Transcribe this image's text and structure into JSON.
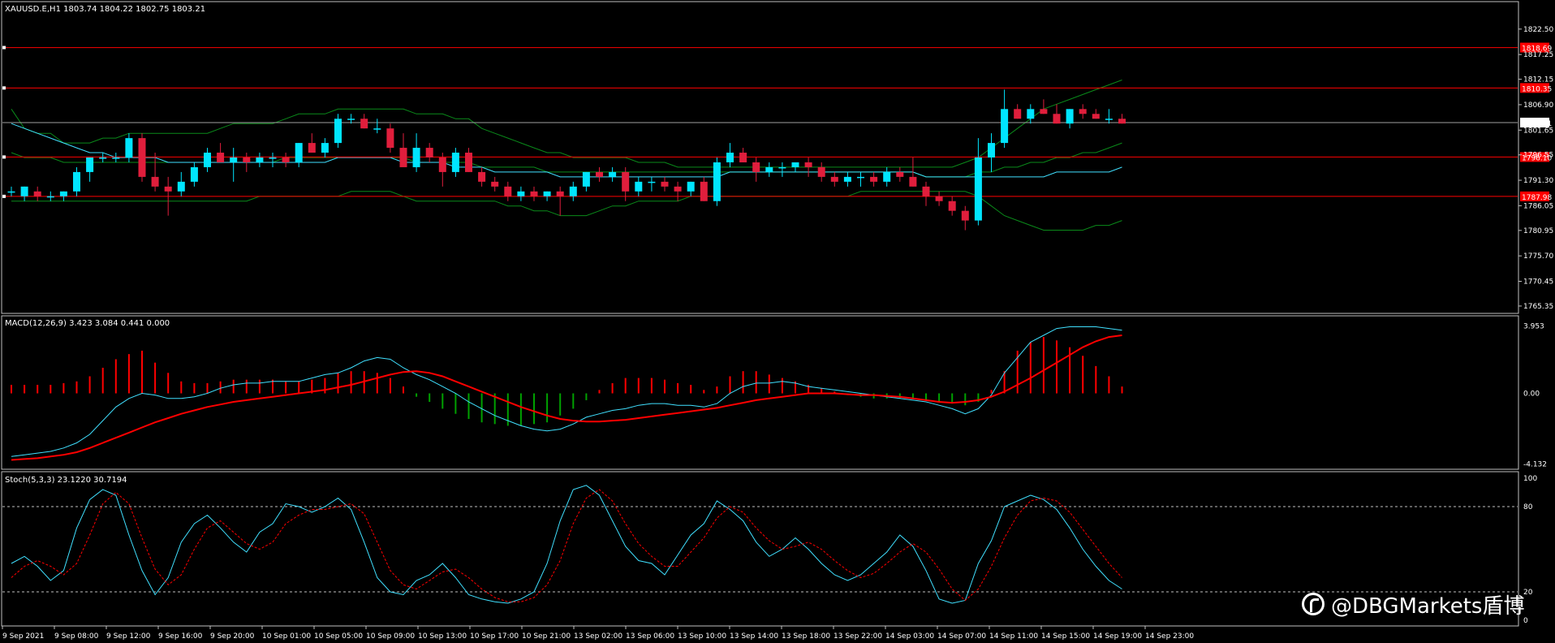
{
  "main": {
    "symbol_info": "XAUUSD.E,H1  1803.74 1804.22 1802.75 1803.21",
    "yrange": [
      1764.0,
      1828.0
    ],
    "price_ticks": [
      "1822.50",
      "1817.25",
      "1812.15",
      "1806.90",
      "1801.65",
      "1796.55",
      "1791.30",
      "1786.05",
      "1780.95",
      "1775.70",
      "1770.45",
      "1765.35"
    ],
    "price_tick_values": [
      1822.5,
      1817.25,
      1812.15,
      1806.9,
      1801.65,
      1796.55,
      1791.3,
      1786.05,
      1780.95,
      1775.7,
      1770.45,
      1765.35
    ],
    "hlines": [
      {
        "label": "1818.69",
        "value": 1818.69
      },
      {
        "label": "1810.35",
        "value": 1810.35
      },
      {
        "label": "1796.10",
        "value": 1796.1
      },
      {
        "label": "1787.98",
        "value": 1787.98
      }
    ],
    "current_price": {
      "label": "1803.21",
      "value": 1803.21
    },
    "candles": [
      [
        1789,
        1790,
        1788,
        1789
      ],
      [
        1788,
        1790,
        1787,
        1790
      ],
      [
        1789,
        1790,
        1787,
        1788
      ],
      [
        1788,
        1789,
        1787,
        1788
      ],
      [
        1788,
        1789,
        1787,
        1789
      ],
      [
        1789,
        1794,
        1788,
        1793
      ],
      [
        1793,
        1796,
        1791,
        1796
      ],
      [
        1796,
        1797,
        1795,
        1796
      ],
      [
        1796,
        1797,
        1795,
        1796
      ],
      [
        1796,
        1801,
        1795,
        1800
      ],
      [
        1800,
        1801,
        1791,
        1792
      ],
      [
        1792,
        1797,
        1789,
        1790
      ],
      [
        1790,
        1792,
        1784,
        1789
      ],
      [
        1789,
        1793,
        1788,
        1791
      ],
      [
        1791,
        1795,
        1790,
        1794
      ],
      [
        1794,
        1798,
        1793,
        1797
      ],
      [
        1797,
        1799,
        1795,
        1795
      ],
      [
        1795,
        1798,
        1791,
        1796
      ],
      [
        1796,
        1797,
        1793,
        1795
      ],
      [
        1795,
        1797,
        1794,
        1796
      ],
      [
        1796,
        1797,
        1794,
        1796
      ],
      [
        1796,
        1797,
        1794,
        1795
      ],
      [
        1795,
        1799,
        1794,
        1799
      ],
      [
        1799,
        1801,
        1797,
        1797
      ],
      [
        1797,
        1800,
        1796,
        1799
      ],
      [
        1799,
        1805,
        1798,
        1804
      ],
      [
        1804,
        1805,
        1803,
        1804
      ],
      [
        1804,
        1805,
        1802,
        1802
      ],
      [
        1802,
        1804,
        1801,
        1802
      ],
      [
        1802,
        1803,
        1797,
        1798
      ],
      [
        1798,
        1801,
        1795,
        1794
      ],
      [
        1794,
        1801,
        1793,
        1798
      ],
      [
        1798,
        1799,
        1795,
        1796
      ],
      [
        1796,
        1797,
        1790,
        1793
      ],
      [
        1793,
        1798,
        1792,
        1797
      ],
      [
        1797,
        1798,
        1793,
        1793
      ],
      [
        1793,
        1794,
        1790,
        1791
      ],
      [
        1791,
        1792,
        1789,
        1790
      ],
      [
        1790,
        1791,
        1787,
        1788
      ],
      [
        1788,
        1790,
        1787,
        1789
      ],
      [
        1789,
        1790,
        1787,
        1788
      ],
      [
        1788,
        1789,
        1787,
        1789
      ],
      [
        1789,
        1790,
        1784,
        1788
      ],
      [
        1788,
        1791,
        1787,
        1790
      ],
      [
        1790,
        1793,
        1789,
        1793
      ],
      [
        1793,
        1794,
        1791,
        1792
      ],
      [
        1792,
        1794,
        1791,
        1793
      ],
      [
        1793,
        1794,
        1787,
        1789
      ],
      [
        1789,
        1792,
        1788,
        1791
      ],
      [
        1791,
        1792,
        1789,
        1791
      ],
      [
        1791,
        1792,
        1789,
        1790
      ],
      [
        1790,
        1791,
        1787,
        1789
      ],
      [
        1789,
        1791,
        1788,
        1791
      ],
      [
        1791,
        1792,
        1787,
        1787
      ],
      [
        1787,
        1796,
        1786,
        1795
      ],
      [
        1795,
        1799,
        1794,
        1797
      ],
      [
        1797,
        1798,
        1795,
        1795
      ],
      [
        1795,
        1796,
        1791,
        1793
      ],
      [
        1793,
        1795,
        1792,
        1794
      ],
      [
        1794,
        1795,
        1792,
        1794
      ],
      [
        1794,
        1795,
        1793,
        1795
      ],
      [
        1795,
        1796,
        1792,
        1794
      ],
      [
        1794,
        1795,
        1791,
        1792
      ],
      [
        1792,
        1793,
        1790,
        1791
      ],
      [
        1791,
        1793,
        1790,
        1792
      ],
      [
        1792,
        1793,
        1790,
        1792
      ],
      [
        1792,
        1793,
        1790,
        1791
      ],
      [
        1791,
        1794,
        1790,
        1793
      ],
      [
        1793,
        1794,
        1791,
        1792
      ],
      [
        1792,
        1796,
        1790,
        1790
      ],
      [
        1790,
        1791,
        1786,
        1788
      ],
      [
        1788,
        1789,
        1786,
        1787
      ],
      [
        1787,
        1788,
        1784,
        1785
      ],
      [
        1785,
        1786,
        1781,
        1783
      ],
      [
        1783,
        1800,
        1782,
        1796
      ],
      [
        1796,
        1801,
        1793,
        1799
      ],
      [
        1799,
        1810,
        1798,
        1806
      ],
      [
        1806,
        1807,
        1804,
        1804
      ],
      [
        1804,
        1807,
        1803,
        1806
      ],
      [
        1806,
        1808,
        1805,
        1805
      ],
      [
        1805,
        1807,
        1803,
        1803
      ],
      [
        1803,
        1806,
        1802,
        1806
      ],
      [
        1806,
        1807,
        1804,
        1805
      ],
      [
        1805,
        1806,
        1804,
        1804
      ],
      [
        1804,
        1806,
        1803,
        1804
      ],
      [
        1804,
        1805,
        1803,
        1803
      ]
    ],
    "bands": {
      "upper": [
        1806,
        1802,
        1801,
        1801,
        1799,
        1799,
        1799,
        1800,
        1800,
        1801,
        1801,
        1801,
        1801,
        1801,
        1801,
        1801,
        1802,
        1803,
        1803,
        1803,
        1803,
        1804,
        1805,
        1805,
        1805,
        1806,
        1806,
        1806,
        1806,
        1806,
        1806,
        1805,
        1805,
        1805,
        1804,
        1804,
        1802,
        1801,
        1800,
        1799,
        1798,
        1797,
        1797,
        1796,
        1796,
        1796,
        1796,
        1796,
        1795,
        1795,
        1795,
        1794,
        1794,
        1794,
        1794,
        1794,
        1794,
        1794,
        1794,
        1794,
        1794,
        1794,
        1794,
        1794,
        1794,
        1794,
        1794,
        1794,
        1794,
        1794,
        1794,
        1794,
        1794,
        1795,
        1796,
        1798,
        1800,
        1802,
        1804,
        1806,
        1807,
        1808,
        1809,
        1810,
        1811,
        1812
      ],
      "middle": [
        1797,
        1796,
        1796,
        1796,
        1795,
        1795,
        1795,
        1795,
        1795,
        1795,
        1795,
        1795,
        1795,
        1795,
        1795,
        1795,
        1795,
        1795,
        1795,
        1795,
        1795,
        1796,
        1796,
        1796,
        1796,
        1796,
        1796,
        1796,
        1796,
        1796,
        1796,
        1795,
        1795,
        1795,
        1795,
        1795,
        1794,
        1794,
        1794,
        1794,
        1794,
        1793,
        1793,
        1793,
        1793,
        1793,
        1793,
        1793,
        1793,
        1793,
        1793,
        1793,
        1793,
        1793,
        1793,
        1793,
        1793,
        1793,
        1793,
        1793,
        1793,
        1793,
        1793,
        1793,
        1793,
        1793,
        1793,
        1793,
        1793,
        1793,
        1792,
        1792,
        1792,
        1792,
        1793,
        1793,
        1794,
        1794,
        1795,
        1795,
        1796,
        1796,
        1797,
        1797,
        1798,
        1799
      ],
      "lower": [
        1787,
        1787,
        1787,
        1787,
        1787,
        1787,
        1787,
        1787,
        1787,
        1787,
        1787,
        1787,
        1787,
        1787,
        1787,
        1787,
        1787,
        1787,
        1787,
        1788,
        1788,
        1788,
        1788,
        1788,
        1788,
        1788,
        1789,
        1789,
        1789,
        1789,
        1788,
        1787,
        1787,
        1787,
        1787,
        1787,
        1787,
        1787,
        1786,
        1786,
        1785,
        1785,
        1784,
        1784,
        1784,
        1785,
        1786,
        1786,
        1787,
        1787,
        1787,
        1787,
        1788,
        1788,
        1788,
        1788,
        1788,
        1788,
        1788,
        1788,
        1788,
        1788,
        1788,
        1788,
        1788,
        1789,
        1789,
        1789,
        1789,
        1789,
        1789,
        1789,
        1789,
        1789,
        1788,
        1786,
        1784,
        1783,
        1782,
        1781,
        1781,
        1781,
        1781,
        1782,
        1782,
        1783
      ]
    },
    "ma": {
      "cyan": [
        1803,
        1802,
        1801,
        1800,
        1799,
        1798,
        1797,
        1797,
        1796,
        1796,
        1796,
        1796,
        1795,
        1795,
        1795,
        1795,
        1795,
        1795,
        1795,
        1795,
        1795,
        1795,
        1795,
        1795,
        1795,
        1796,
        1796,
        1796,
        1796,
        1796,
        1795,
        1795,
        1795,
        1795,
        1794,
        1794,
        1794,
        1793,
        1793,
        1793,
        1793,
        1793,
        1792,
        1792,
        1792,
        1792,
        1792,
        1792,
        1792,
        1792,
        1792,
        1792,
        1792,
        1792,
        1792,
        1793,
        1793,
        1793,
        1793,
        1793,
        1793,
        1793,
        1793,
        1793,
        1793,
        1793,
        1793,
        1793,
        1793,
        1793,
        1792,
        1792,
        1792,
        1792,
        1792,
        1792,
        1792,
        1792,
        1792,
        1792,
        1793,
        1793,
        1793,
        1793,
        1793,
        1794
      ]
    }
  },
  "macd": {
    "label": "MACD(12,26,9) 3.423 3.084 0.441 0.000",
    "yrange": [
      -4.4,
      4.4
    ],
    "ticks": [
      "3.953",
      "0.00",
      "-4.132"
    ],
    "tick_values": [
      3.953,
      0.0,
      -4.132
    ],
    "histogram": [
      0.5,
      0.5,
      0.5,
      0.5,
      0.6,
      0.7,
      1.0,
      1.5,
      2.0,
      2.3,
      2.5,
      1.8,
      1.2,
      0.7,
      0.6,
      0.6,
      0.7,
      0.8,
      0.8,
      0.8,
      0.8,
      0.7,
      0.7,
      0.8,
      0.9,
      1.2,
      1.3,
      1.3,
      1.2,
      0.9,
      0.4,
      -0.2,
      -0.5,
      -0.9,
      -1.2,
      -1.5,
      -1.7,
      -1.8,
      -1.9,
      -1.9,
      -1.8,
      -1.7,
      -1.3,
      -0.9,
      -0.4,
      0.2,
      0.6,
      0.9,
      0.9,
      0.9,
      0.8,
      0.6,
      0.5,
      0.2,
      0.4,
      1.0,
      1.3,
      1.3,
      1.1,
      0.9,
      0.7,
      0.5,
      0.3,
      0.1,
      -0.1,
      -0.2,
      -0.3,
      -0.3,
      -0.3,
      -0.3,
      -0.4,
      -0.5,
      -0.6,
      -0.7,
      -0.5,
      0.2,
      1.3,
      2.5,
      3.0,
      3.3,
      3.1,
      2.7,
      2.2,
      1.6,
      1.0,
      0.4
    ],
    "signal": [
      -3.9,
      -3.85,
      -3.8,
      -3.7,
      -3.6,
      -3.45,
      -3.2,
      -2.9,
      -2.6,
      -2.3,
      -2.0,
      -1.7,
      -1.45,
      -1.2,
      -1.0,
      -0.8,
      -0.65,
      -0.5,
      -0.4,
      -0.3,
      -0.2,
      -0.1,
      0.0,
      0.1,
      0.2,
      0.35,
      0.5,
      0.7,
      0.9,
      1.1,
      1.25,
      1.3,
      1.2,
      1.0,
      0.7,
      0.4,
      0.1,
      -0.2,
      -0.5,
      -0.8,
      -1.05,
      -1.3,
      -1.5,
      -1.6,
      -1.65,
      -1.65,
      -1.6,
      -1.55,
      -1.45,
      -1.35,
      -1.25,
      -1.15,
      -1.05,
      -0.95,
      -0.85,
      -0.7,
      -0.55,
      -0.4,
      -0.3,
      -0.2,
      -0.1,
      0.0,
      0.0,
      0.0,
      -0.05,
      -0.1,
      -0.1,
      -0.15,
      -0.2,
      -0.3,
      -0.4,
      -0.5,
      -0.55,
      -0.5,
      -0.4,
      -0.2,
      0.1,
      0.5,
      0.9,
      1.35,
      1.8,
      2.25,
      2.7,
      3.05,
      3.3,
      3.4
    ],
    "macd_line": [
      -3.7,
      -3.6,
      -3.5,
      -3.4,
      -3.2,
      -2.9,
      -2.4,
      -1.6,
      -0.8,
      -0.3,
      0.0,
      -0.1,
      -0.3,
      -0.3,
      -0.2,
      0.0,
      0.3,
      0.5,
      0.6,
      0.6,
      0.7,
      0.7,
      0.7,
      0.9,
      1.1,
      1.2,
      1.5,
      1.9,
      2.1,
      2.0,
      1.5,
      1.1,
      0.8,
      0.4,
      0.0,
      -0.5,
      -0.9,
      -1.3,
      -1.6,
      -1.9,
      -2.1,
      -2.2,
      -2.1,
      -1.8,
      -1.4,
      -1.2,
      -1.0,
      -0.9,
      -0.7,
      -0.6,
      -0.6,
      -0.7,
      -0.7,
      -0.8,
      -0.6,
      0.0,
      0.4,
      0.6,
      0.6,
      0.7,
      0.6,
      0.4,
      0.3,
      0.2,
      0.1,
      0.0,
      -0.1,
      -0.2,
      -0.3,
      -0.4,
      -0.5,
      -0.7,
      -0.9,
      -1.2,
      -0.9,
      -0.1,
      1.2,
      2.1,
      3.0,
      3.4,
      3.8,
      3.9,
      3.9,
      3.9,
      3.8,
      3.7
    ]
  },
  "stoch": {
    "label": "Stoch(5,3,3) 23.1220 30.7194",
    "ticks": [
      "100",
      "80",
      "20",
      "0"
    ],
    "tick_values": [
      100,
      80,
      20,
      0
    ],
    "main": [
      40,
      45,
      38,
      28,
      35,
      65,
      85,
      92,
      88,
      60,
      35,
      18,
      30,
      55,
      68,
      74,
      65,
      55,
      48,
      62,
      68,
      82,
      80,
      76,
      80,
      86,
      78,
      55,
      30,
      20,
      18,
      28,
      32,
      40,
      30,
      18,
      15,
      13,
      12,
      15,
      20,
      40,
      70,
      92,
      95,
      88,
      70,
      52,
      42,
      40,
      32,
      46,
      60,
      68,
      84,
      78,
      70,
      55,
      45,
      50,
      58,
      50,
      40,
      32,
      28,
      32,
      40,
      48,
      60,
      52,
      35,
      15,
      12,
      14,
      40,
      56,
      80,
      84,
      88,
      85,
      78,
      65,
      50,
      38,
      28,
      22
    ],
    "signal": [
      30,
      38,
      42,
      38,
      32,
      40,
      60,
      82,
      90,
      82,
      58,
      36,
      25,
      32,
      50,
      65,
      70,
      62,
      54,
      50,
      55,
      68,
      74,
      78,
      78,
      80,
      82,
      75,
      55,
      35,
      25,
      22,
      28,
      34,
      36,
      30,
      22,
      16,
      13,
      13,
      16,
      25,
      42,
      68,
      86,
      92,
      84,
      68,
      54,
      45,
      38,
      38,
      48,
      58,
      72,
      80,
      76,
      65,
      56,
      50,
      52,
      55,
      50,
      42,
      35,
      30,
      33,
      40,
      48,
      54,
      48,
      36,
      22,
      14,
      22,
      38,
      58,
      74,
      84,
      86,
      84,
      76,
      64,
      52,
      40,
      30
    ]
  },
  "time_axis": {
    "labels": [
      "9 Sep 2021",
      "9 Sep 08:00",
      "9 Sep 12:00",
      "9 Sep 16:00",
      "9 Sep 20:00",
      "10 Sep 01:00",
      "10 Sep 05:00",
      "10 Sep 09:00",
      "10 Sep 13:00",
      "10 Sep 17:00",
      "10 Sep 21:00",
      "13 Sep 02:00",
      "13 Sep 06:00",
      "13 Sep 10:00",
      "13 Sep 14:00",
      "13 Sep 18:00",
      "13 Sep 22:00",
      "14 Sep 03:00",
      "14 Sep 07:00",
      "14 Sep 11:00",
      "14 Sep 15:00",
      "14 Sep 19:00",
      "14 Sep 23:00"
    ]
  },
  "watermark": {
    "icon": "weibo-icon",
    "text": "@DBGMarkets盾博"
  },
  "colors": {
    "bull": "#00e5ff",
    "bear": "#e01e3c",
    "band": "#0a8a1a",
    "level": "#ff0000",
    "macd_pos": "#ff0000",
    "macd_neg": "#00a000",
    "signal": "#ff0000",
    "cyan": "#40e0ff",
    "grid": "#c0c0c0"
  }
}
